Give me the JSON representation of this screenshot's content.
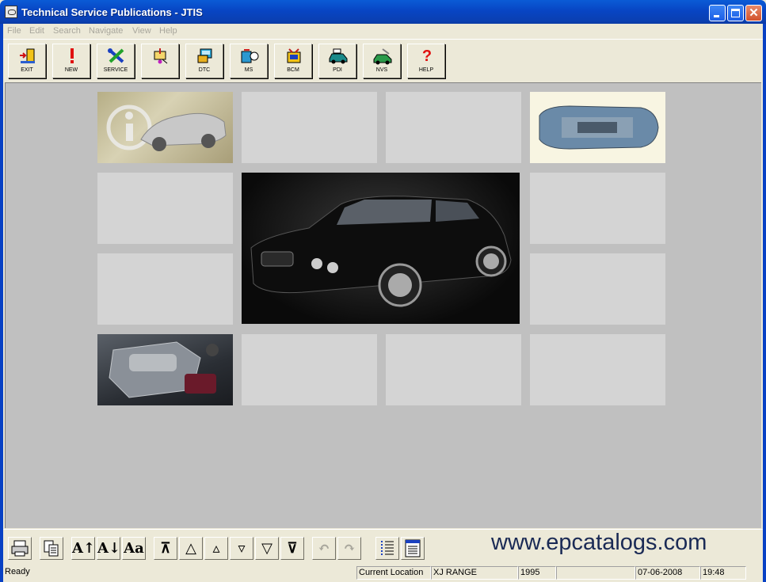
{
  "window": {
    "title": "Technical Service Publications - JTIS"
  },
  "menu": [
    "File",
    "Edit",
    "Search",
    "Navigate",
    "View",
    "Help"
  ],
  "toolbar": [
    {
      "label": "EXIT",
      "icon": "exit-door-icon"
    },
    {
      "label": "NEW",
      "icon": "exclamation-icon"
    },
    {
      "label": "SERVICE",
      "icon": "wrench-screwdriver-icon"
    },
    {
      "label": "",
      "icon": "diagnostic-probe-icon"
    },
    {
      "label": "DTC",
      "icon": "dtc-tester-icon"
    },
    {
      "label": "MS",
      "icon": "multimeter-icon"
    },
    {
      "label": "BCM",
      "icon": "battery-module-icon"
    },
    {
      "label": "PDI",
      "icon": "car-inspection-icon"
    },
    {
      "label": "NVS",
      "icon": "nvs-car-icon"
    },
    {
      "label": "HELP",
      "icon": "question-mark-icon"
    }
  ],
  "bottom_toolbar": [
    {
      "icon": "print-icon",
      "glyph": "",
      "enabled": true
    },
    {
      "icon": "copy-icon",
      "glyph": "",
      "enabled": true
    },
    {
      "icon": "font-larger-icon",
      "glyph": "A↑",
      "enabled": true
    },
    {
      "icon": "font-smaller-icon",
      "glyph": "A↓",
      "enabled": true
    },
    {
      "icon": "font-toggle-icon",
      "glyph": "Aa",
      "enabled": true
    },
    {
      "icon": "first-page-icon",
      "glyph": "⊼",
      "enabled": true
    },
    {
      "icon": "previous-page-icon",
      "glyph": "△",
      "enabled": true
    },
    {
      "icon": "previous-item-icon",
      "glyph": "▵",
      "enabled": true
    },
    {
      "icon": "next-item-icon",
      "glyph": "▿",
      "enabled": true
    },
    {
      "icon": "next-page-icon",
      "glyph": "▽",
      "enabled": true
    },
    {
      "icon": "last-page-icon",
      "glyph": "⊽",
      "enabled": true
    },
    {
      "icon": "back-icon",
      "glyph": "↶",
      "enabled": false
    },
    {
      "icon": "forward-icon",
      "glyph": "↷",
      "enabled": false
    },
    {
      "icon": "list-icon",
      "glyph": "",
      "enabled": true
    },
    {
      "icon": "document-icon",
      "glyph": "",
      "enabled": true
    }
  ],
  "watermark": "www.epcatalogs.com",
  "status": {
    "ready": "Ready",
    "location_label": "Current Location",
    "model": "XJ RANGE",
    "year": "1995",
    "blank": "",
    "date": "07-06-2008",
    "time": "19:48"
  }
}
